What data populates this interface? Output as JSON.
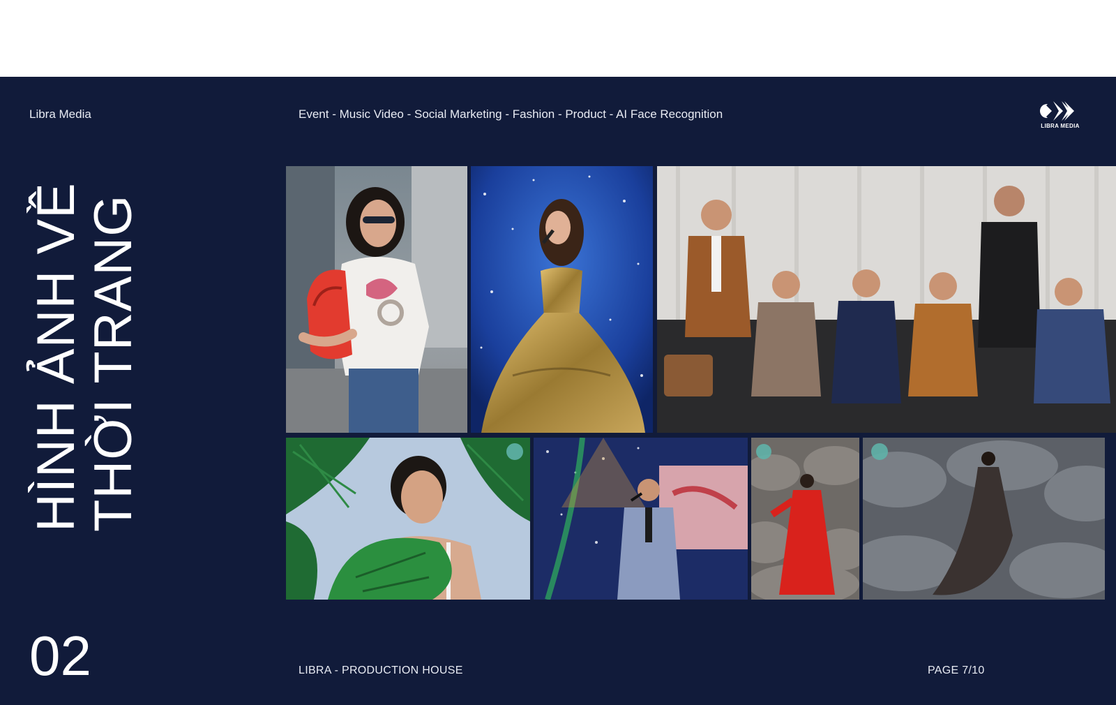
{
  "header": {
    "brand": "Libra Media",
    "services": "Event - Music Video - Social Marketing - Fashion - Product - AI Face Recognition",
    "logo_text": "LIBRA MEDIA"
  },
  "title": {
    "line1": "HÌNH ẢNH VỀ",
    "line2": "THỜI TRANG"
  },
  "section_number": "02",
  "footer": {
    "left": "LIBRA - PRODUCTION HOUSE",
    "right": "PAGE 7/10"
  },
  "colors": {
    "background": "#111b3a",
    "text": "#ffffff"
  }
}
